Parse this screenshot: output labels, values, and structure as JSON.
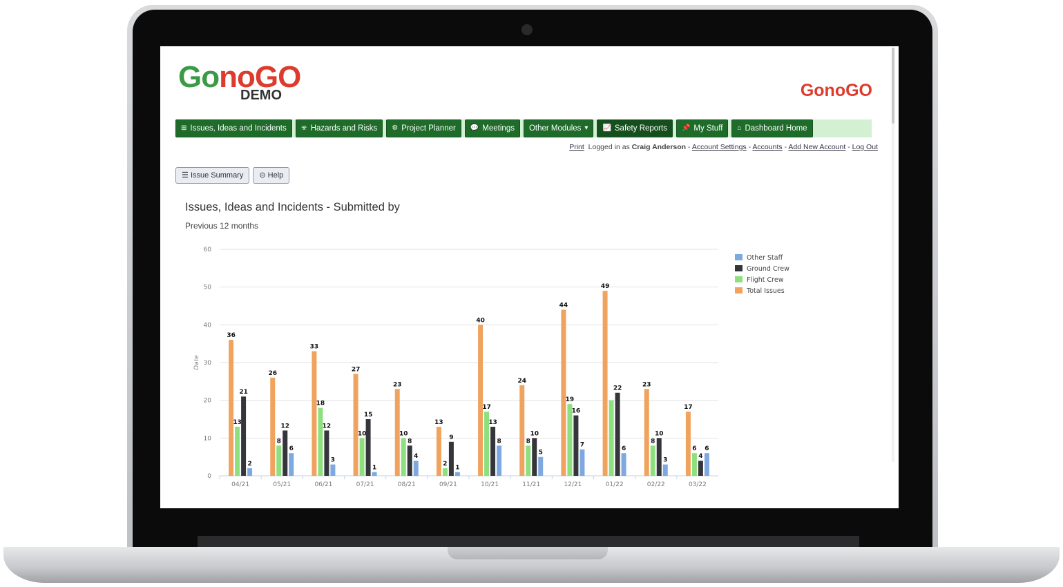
{
  "app": {
    "logo_text_go": "Go",
    "logo_text_nogo": "noGO",
    "logo_subtitle": "DEMO",
    "logo_small": "GonoGO"
  },
  "nav": [
    {
      "label": "Issues, Ideas and Incidents",
      "icon": "plus-square-icon"
    },
    {
      "label": "Hazards and Risks",
      "icon": "biohazard-icon"
    },
    {
      "label": "Project Planner",
      "icon": "cogs-icon"
    },
    {
      "label": "Meetings",
      "icon": "comments-icon"
    },
    {
      "label": "Other Modules",
      "icon": "caret-down-icon"
    },
    {
      "label": "Safety Reports",
      "icon": "line-chart-icon"
    },
    {
      "label": "My Stuff",
      "icon": "thumbtack-icon"
    },
    {
      "label": "Dashboard Home",
      "icon": "home-icon"
    }
  ],
  "userbar": {
    "print": "Print",
    "logged_in_as": "Logged in as",
    "user": "Craig Anderson",
    "account_settings": "Account Settings",
    "accounts": "Accounts",
    "add_new_account": "Add New Account",
    "log_out": "Log Out",
    "sep": "-"
  },
  "toolbar": {
    "issue_summary": "Issue Summary",
    "help": "Help"
  },
  "colors": {
    "nav_green": "#1f6b2a",
    "total": "#f0a35e",
    "flight": "#8ee07f",
    "ground": "#35363b",
    "other": "#7ea9e0"
  },
  "chart_data": {
    "type": "bar",
    "title": "Issues, Ideas and Incidents - Submitted by",
    "subtitle": "Previous 12 months",
    "ylabel": "Date",
    "ylim": [
      0,
      60
    ],
    "yticks": [
      0,
      10,
      20,
      30,
      40,
      50,
      60
    ],
    "grid": true,
    "legend": "top-right",
    "categories": [
      "04/21",
      "05/21",
      "06/21",
      "07/21",
      "08/21",
      "09/21",
      "10/21",
      "11/21",
      "12/21",
      "01/22",
      "02/22",
      "03/22"
    ],
    "series": [
      {
        "name": "Total Issues",
        "color": "#f0a35e",
        "values": [
          36,
          26,
          33,
          27,
          23,
          13,
          40,
          24,
          44,
          49,
          23,
          17
        ],
        "labels": [
          true,
          true,
          true,
          true,
          true,
          true,
          true,
          true,
          true,
          true,
          true,
          true
        ]
      },
      {
        "name": "Flight Crew",
        "color": "#8ee07f",
        "values": [
          13,
          8,
          18,
          10,
          10,
          2,
          17,
          8,
          19,
          20,
          8,
          6
        ],
        "labels": [
          true,
          true,
          true,
          true,
          true,
          true,
          true,
          true,
          true,
          false,
          true,
          true
        ]
      },
      {
        "name": "Ground Crew",
        "color": "#35363b",
        "values": [
          21,
          12,
          12,
          15,
          8,
          9,
          13,
          10,
          16,
          22,
          10,
          4
        ],
        "labels": [
          true,
          true,
          true,
          true,
          true,
          true,
          true,
          true,
          true,
          true,
          true,
          true
        ]
      },
      {
        "name": "Other Staff",
        "color": "#7ea9e0",
        "values": [
          2,
          6,
          3,
          1,
          4,
          1,
          8,
          5,
          7,
          6,
          3,
          6
        ],
        "labels": [
          true,
          true,
          true,
          true,
          true,
          true,
          true,
          true,
          true,
          true,
          true,
          true
        ]
      }
    ],
    "legend_order": [
      "Other Staff",
      "Ground Crew",
      "Flight Crew",
      "Total Issues"
    ]
  }
}
